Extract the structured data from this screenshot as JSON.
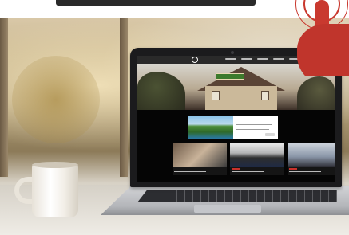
{
  "image": {
    "headline": "",
    "background_color": "#c9b78f",
    "accent_color": "#c0352c"
  },
  "website": {
    "header_logo": "",
    "nav_items": [
      "",
      "",
      "",
      "",
      ""
    ],
    "hero_title": "",
    "promo_title": "",
    "card_tag_color": "#c8312b"
  },
  "icons": {
    "hand": "pointing-hand-icon",
    "mug": "coffee-mug-icon",
    "laptop": "laptop-icon"
  }
}
